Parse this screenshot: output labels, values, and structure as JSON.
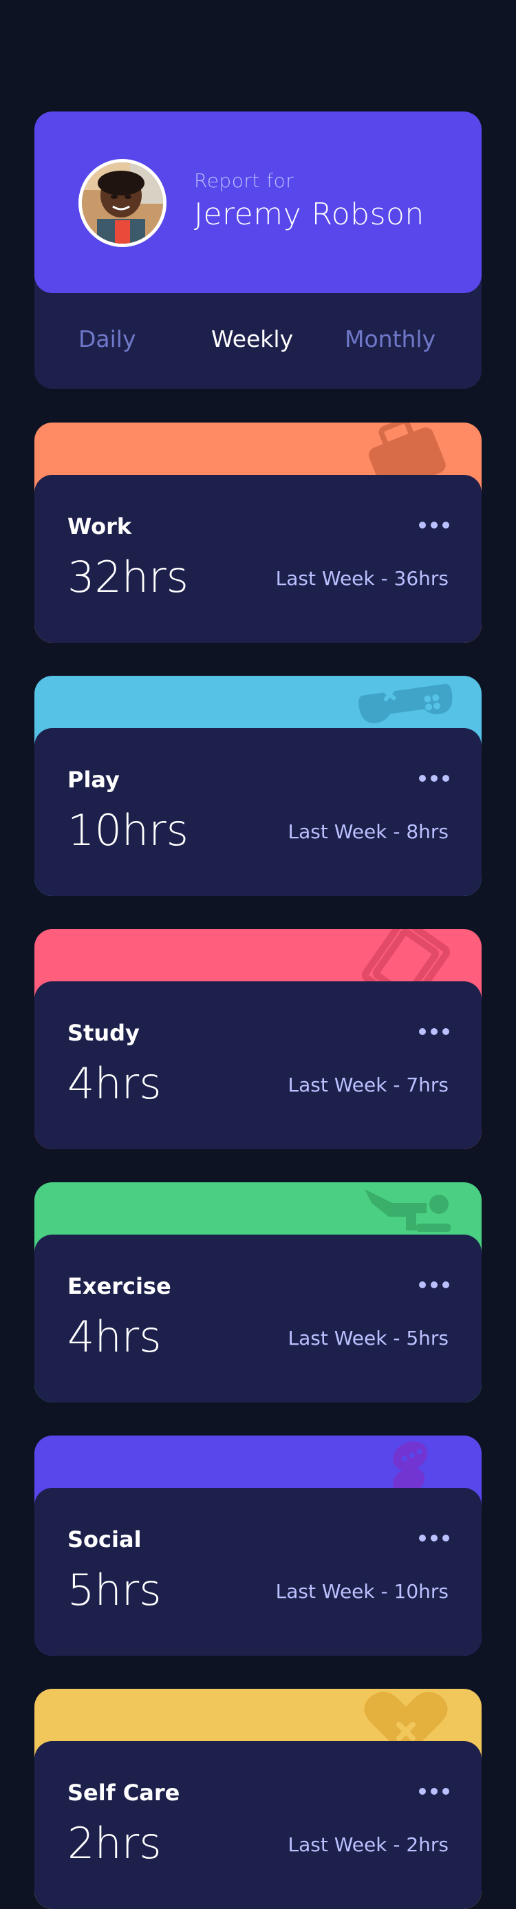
{
  "profile": {
    "report_for": "Report for",
    "name": "Jeremy Robson"
  },
  "tabs": [
    {
      "label": "Daily",
      "active": false
    },
    {
      "label": "Weekly",
      "active": true
    },
    {
      "label": "Monthly",
      "active": false
    }
  ],
  "activities": [
    {
      "title": "Work",
      "current": "32hrs",
      "previous": "Last Week - 36hrs",
      "color": "#ff8b64",
      "icon": "briefcase-icon"
    },
    {
      "title": "Play",
      "current": "10hrs",
      "previous": "Last Week - 8hrs",
      "color": "#55c2e6",
      "icon": "gamepad-icon"
    },
    {
      "title": "Study",
      "current": "4hrs",
      "previous": "Last Week - 7hrs",
      "color": "#ff5e7d",
      "icon": "book-icon"
    },
    {
      "title": "Exercise",
      "current": "4hrs",
      "previous": "Last Week - 5hrs",
      "color": "#4bcf82",
      "icon": "running-icon"
    },
    {
      "title": "Social",
      "current": "5hrs",
      "previous": "Last Week - 10hrs",
      "color": "#7335d2",
      "icon": "chat-icon"
    },
    {
      "title": "Self Care",
      "current": "2hrs",
      "previous": "Last Week - 2hrs",
      "color": "#f1c75b",
      "icon": "heart-icon"
    }
  ],
  "colors": {
    "background": "#0e1323",
    "card": "#1c204b",
    "accent": "#5847eb",
    "muted_text": "#bbc0ff",
    "inactive_tab": "#7078c9"
  }
}
